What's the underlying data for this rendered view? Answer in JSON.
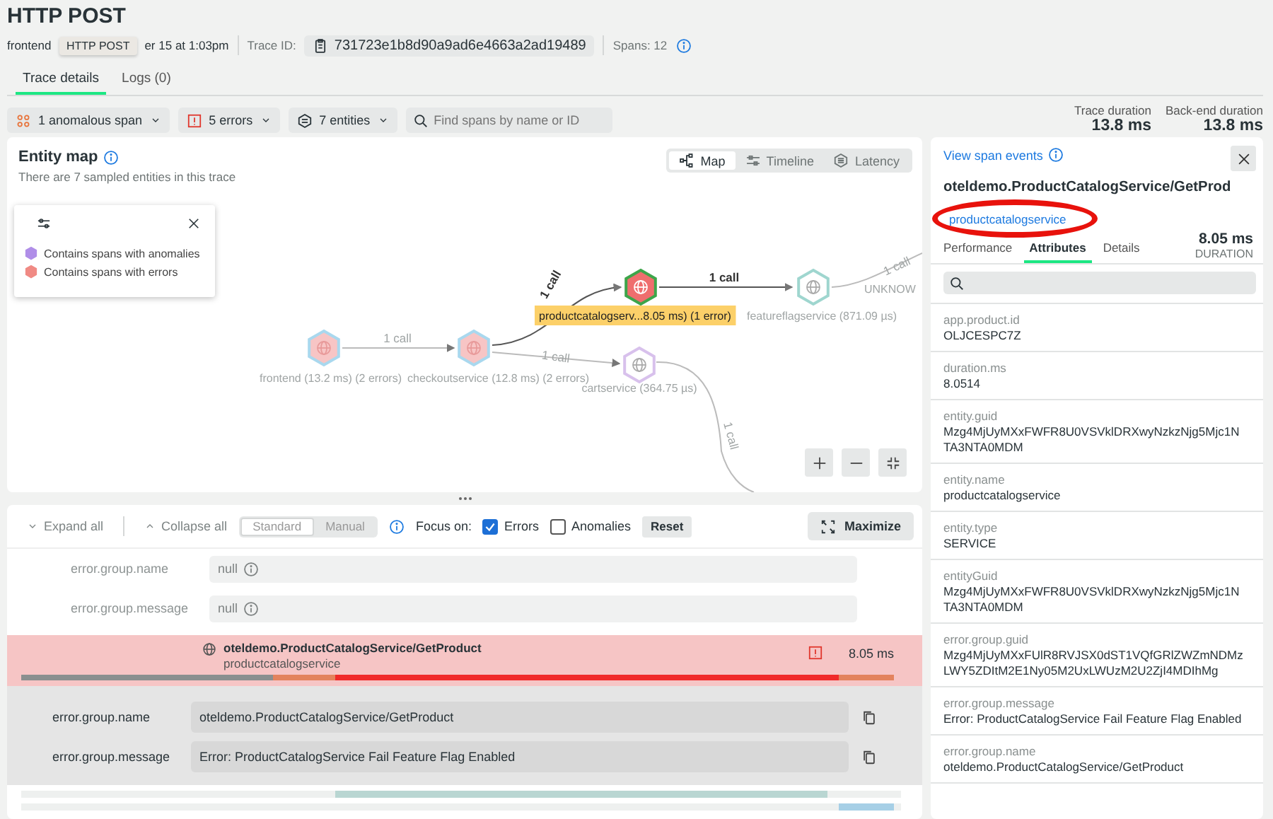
{
  "title": "HTTP POST",
  "meta": {
    "entity": "frontend",
    "date": "er 15 at 1:03pm",
    "trace_id_label": "Trace ID:",
    "trace_id": "731723e1b8d90a9ad6e4663a2ad19489",
    "spans": "Spans: 12"
  },
  "tooltip": "HTTP POST",
  "tabs": [
    {
      "label": "Trace details",
      "selected": true
    },
    {
      "label": "Logs (0)",
      "selected": false
    }
  ],
  "filters": [
    {
      "kind": "anomaly",
      "label": "1 anomalous span"
    },
    {
      "kind": "error",
      "label": "5 errors"
    },
    {
      "kind": "entity",
      "label": "7 entities"
    }
  ],
  "search": {
    "placeholder": "Find spans by name or ID"
  },
  "durations": [
    {
      "label": "Trace duration",
      "value": "13.8 ms"
    },
    {
      "label": "Back-end duration",
      "value": "13.8 ms"
    }
  ],
  "entity_map": {
    "title": "Entity map",
    "subtitle": "There are 7 sampled entities in this trace",
    "views": [
      {
        "kind": "map",
        "label": "Map",
        "selected": true
      },
      {
        "kind": "timeline",
        "label": "Timeline",
        "selected": false
      },
      {
        "kind": "latency",
        "label": "Latency",
        "selected": false
      }
    ],
    "legend": [
      {
        "label": "Contains spans with anomalies",
        "color": "#b08ee8"
      },
      {
        "label": "Contains spans with errors",
        "color": "#f08a84"
      }
    ],
    "nodes": [
      {
        "kind": "error",
        "label": "frontend (13.2 ms) (2 errors)",
        "color": "#a9d8ee",
        "selected": false
      },
      {
        "kind": "error",
        "label": "checkoutservice (12.8 ms) (2 errors)",
        "color": "#a9d8ee",
        "selected": false
      },
      {
        "kind": "error_focus",
        "label": "productcatalogserv...8.05 ms) (1 error)",
        "color": "#3da54a",
        "selected": true
      },
      {
        "kind": "ok",
        "label": "featureflagservice (871.09 µs)",
        "color": "#9fd6cf",
        "selected": false
      },
      {
        "kind": "ok",
        "label": "cartservice (364.75 µs)",
        "color": "#d8c1ec",
        "selected": false
      },
      {
        "kind": "hidden",
        "label": "UNKNOW",
        "selected": false
      }
    ],
    "edges": [
      {
        "label": "1 call",
        "highlighted": false
      },
      {
        "label": "1 call",
        "highlighted": true
      },
      {
        "label": "1 call",
        "highlighted": false
      },
      {
        "label": "1 call",
        "highlighted": true
      },
      {
        "label": "1 call",
        "highlighted": false
      },
      {
        "label": "1 call",
        "highlighted": false
      }
    ]
  },
  "spans_panel": {
    "expand": "Expand all",
    "collapse": "Collapse all",
    "modes": [
      {
        "label": "Standard",
        "selected": true
      },
      {
        "label": "Manual",
        "selected": false
      }
    ],
    "focus_label": "Focus on:",
    "focus": [
      {
        "label": "Errors",
        "checked": true
      },
      {
        "label": "Anomalies",
        "checked": false
      }
    ],
    "reset": "Reset",
    "maximize": "Maximize",
    "faded_attributes": [
      {
        "name": "error.group.name",
        "value": "null"
      },
      {
        "name": "error.group.message",
        "value": "null"
      }
    ],
    "span": {
      "name": "oteldemo.ProductCatalogService/GetProduct",
      "service": "productcatalogservice",
      "duration": "8.05 ms",
      "error": true
    },
    "span_attributes": [
      {
        "name": "error.group.name",
        "value": "oteldemo.ProductCatalogService/GetProduct"
      },
      {
        "name": "error.group.message",
        "value": "Error: ProductCatalogService Fail Feature Flag Enabled"
      }
    ]
  },
  "details": {
    "events_link": "View span events",
    "title": "oteldemo.ProductCatalogService/GetProd",
    "service_link": "productcatalogservice",
    "tabs": [
      {
        "label": "Performance",
        "selected": false
      },
      {
        "label": "Attributes",
        "selected": true
      },
      {
        "label": "Details",
        "selected": false
      }
    ],
    "duration": "8.05 ms",
    "duration_label": "DURATION",
    "attributes": [
      {
        "name": "app.product.id",
        "value": "OLJCESPC7Z"
      },
      {
        "name": "duration.ms",
        "value": "8.0514"
      },
      {
        "name": "entity.guid",
        "value": "Mzg4MjUyMXxFWFR8U0VSVklDRXwyNzkzNjg5Mjc1NTA3NTA0MDM"
      },
      {
        "name": "entity.name",
        "value": "productcatalogservice"
      },
      {
        "name": "entity.type",
        "value": "SERVICE"
      },
      {
        "name": "entityGuid",
        "value": "Mzg4MjUyMXxFWFR8U0VSVklDRXwyNzkzNjg5Mjc1NTA3NTA0MDM"
      },
      {
        "name": "error.group.guid",
        "value": "Mzg4MjUyMXxFUlR8RVJSX0dST1VQfGRlZWZmNDMzLWY5ZDItM2E1Ny05M2UxLWUzM2U2ZjI4MDIhMg"
      },
      {
        "name": "error.group.message",
        "value": "Error: ProductCatalogService Fail Feature Flag Enabled"
      },
      {
        "name": "error.group.name",
        "value": "oteldemo.ProductCatalogService/GetProduct"
      }
    ]
  }
}
